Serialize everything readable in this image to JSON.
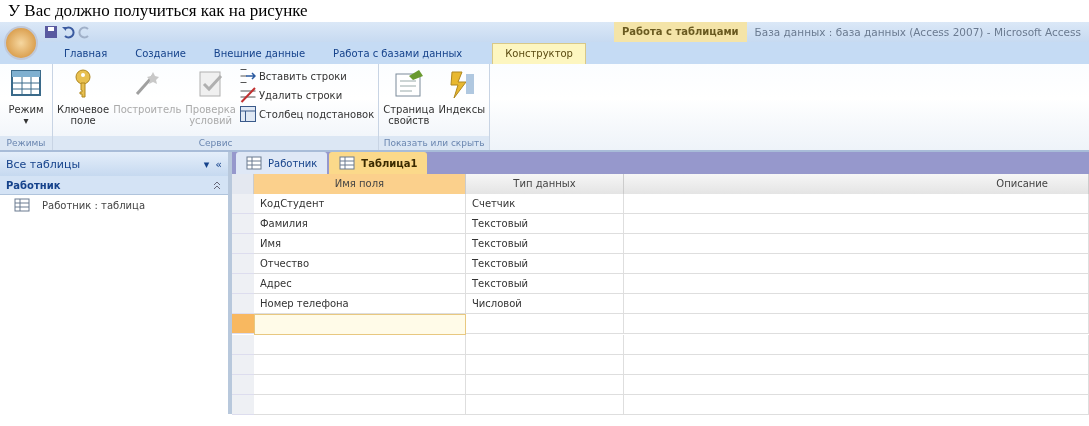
{
  "caption": "У Вас должно получиться как на рисунке",
  "window": {
    "contextual_tab_group": "Работа с таблицами",
    "title": "База данных : база данных (Access 2007) - Microsoft Access"
  },
  "ribbon_tabs": [
    {
      "label": "Главная",
      "selected": false
    },
    {
      "label": "Создание",
      "selected": false
    },
    {
      "label": "Внешние данные",
      "selected": false
    },
    {
      "label": "Работа с базами данных",
      "selected": false
    },
    {
      "label": "Конструктор",
      "selected": true
    }
  ],
  "ribbon_groups": [
    {
      "label": "Режимы",
      "items": [
        {
          "kind": "large",
          "label": "Режим",
          "caret": "▾",
          "disabled": false
        }
      ]
    },
    {
      "label": "Сервис",
      "items": [
        {
          "kind": "large",
          "label": "Ключевое поле",
          "disabled": false
        },
        {
          "kind": "large",
          "label": "Построитель",
          "disabled": true
        },
        {
          "kind": "large",
          "label": "Проверка условий",
          "disabled": true
        },
        {
          "kind": "small",
          "label": "Вставить строки",
          "disabled": false
        },
        {
          "kind": "small",
          "label": "Удалить строки",
          "disabled": false
        },
        {
          "kind": "small",
          "label": "Столбец подстановок",
          "disabled": false
        }
      ]
    },
    {
      "label": "Показать или скрыть",
      "items": [
        {
          "kind": "large",
          "label": "Страница свойств",
          "disabled": false
        },
        {
          "kind": "large",
          "label": "Индексы",
          "disabled": false
        }
      ]
    }
  ],
  "nav_pane": {
    "title": "Все таблицы",
    "menu_glyph": "▾",
    "collapse_glyph": "«",
    "groups": [
      {
        "label": "Работник",
        "expanded": true,
        "items": [
          {
            "label": "Работник : таблица"
          }
        ]
      }
    ]
  },
  "document_tabs": [
    {
      "label": "Работник",
      "selected": false
    },
    {
      "label": "Таблица1",
      "selected": true
    }
  ],
  "design_grid": {
    "columns": [
      "Имя поля",
      "Тип данных",
      "Описание"
    ],
    "rows": [
      {
        "field": "КодСтудент",
        "type": "Счетчик",
        "selected": false
      },
      {
        "field": "Фамилия",
        "type": "Текстовый",
        "selected": false
      },
      {
        "field": "Имя",
        "type": "Текстовый",
        "selected": false
      },
      {
        "field": "Отчество",
        "type": "Текстовый",
        "selected": false
      },
      {
        "field": "Адрес",
        "type": "Текстовый",
        "selected": false
      },
      {
        "field": "Номер телефона",
        "type": "Числовой",
        "selected": false
      },
      {
        "selected": true
      }
    ]
  }
}
